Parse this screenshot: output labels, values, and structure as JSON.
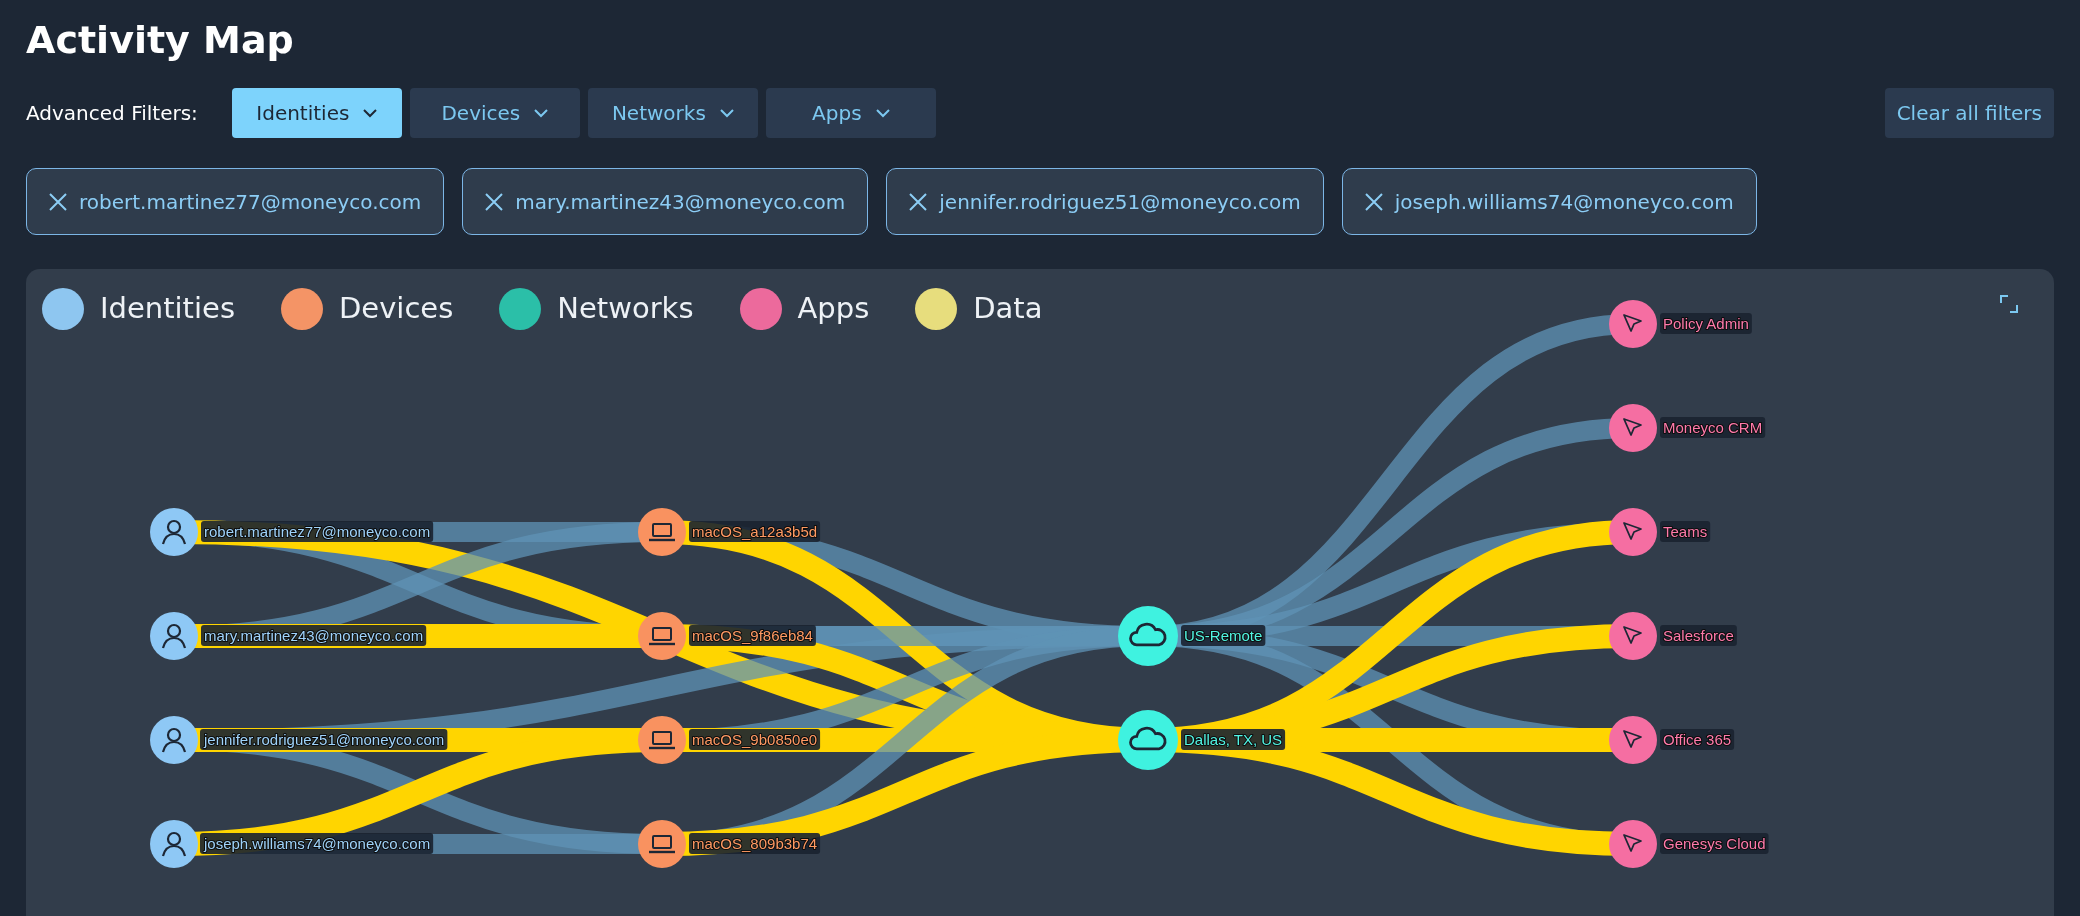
{
  "title": "Activity Map",
  "filters": {
    "label": "Advanced Filters:",
    "buttons": [
      {
        "label": "Identities",
        "selected": true
      },
      {
        "label": "Devices",
        "selected": false
      },
      {
        "label": "Networks",
        "selected": false
      },
      {
        "label": "Apps",
        "selected": false
      }
    ],
    "clear": "Clear all filters"
  },
  "chips": [
    "robert.martinez77@moneyco.com",
    "mary.martinez43@moneyco.com",
    "jennifer.rodriguez51@moneyco.com",
    "joseph.williams74@moneyco.com"
  ],
  "legend": [
    {
      "label": "Identities",
      "color": "#8ec6f0"
    },
    {
      "label": "Devices",
      "color": "#f49466"
    },
    {
      "label": "Networks",
      "color": "#2bbfa8"
    },
    {
      "label": "Apps",
      "color": "#ec6a9c"
    },
    {
      "label": "Data",
      "color": "#e7dd7d"
    }
  ],
  "map": {
    "nodes": [
      {
        "kind": "identity",
        "label": "robert.martinez77@moneyco.com"
      },
      {
        "kind": "identity",
        "label": "mary.martinez43@moneyco.com"
      },
      {
        "kind": "identity",
        "label": "jennifer.rodriguez51@moneyco.com"
      },
      {
        "kind": "identity",
        "label": "joseph.williams74@moneyco.com"
      },
      {
        "kind": "device",
        "label": "macOS_a12a3b5d"
      },
      {
        "kind": "device",
        "label": "macOS_9f86eb84"
      },
      {
        "kind": "device",
        "label": "macOS_9b0850e0"
      },
      {
        "kind": "device",
        "label": "macOS_809b3b74"
      },
      {
        "kind": "network",
        "label": "US-Remote"
      },
      {
        "kind": "network",
        "label": "Dallas, TX, US"
      },
      {
        "kind": "app",
        "label": "Policy Admin"
      },
      {
        "kind": "app",
        "label": "Moneyco CRM"
      },
      {
        "kind": "app",
        "label": "Teams"
      },
      {
        "kind": "app",
        "label": "Salesforce"
      },
      {
        "kind": "app",
        "label": "Office 365"
      },
      {
        "kind": "app",
        "label": "Genesys Cloud"
      }
    ]
  }
}
